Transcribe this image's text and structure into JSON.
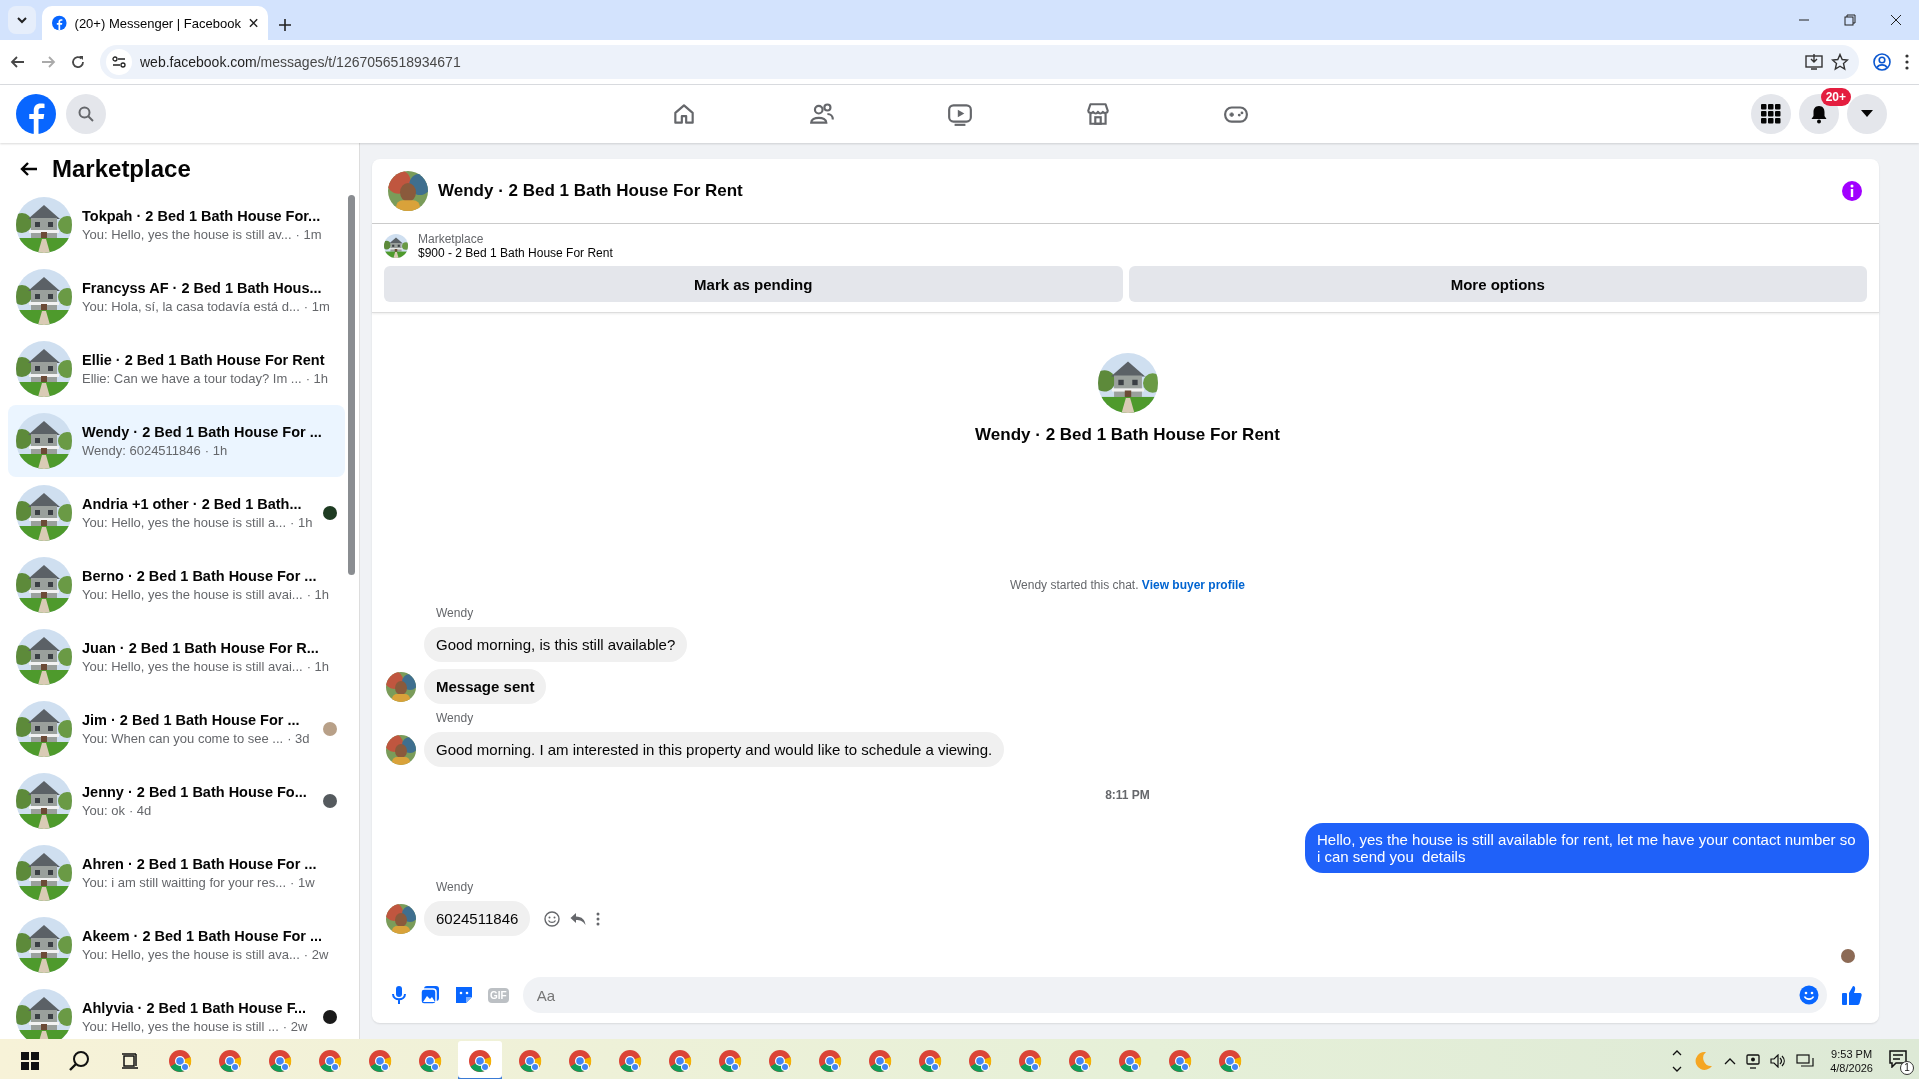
{
  "browser": {
    "tab_title": "(20+) Messenger | Facebook",
    "url_host": "web.facebook.com",
    "url_path": "/messages/t/1267056518934671"
  },
  "topbar": {
    "nav": [
      {
        "kind": "home"
      },
      {
        "kind": "friends"
      },
      {
        "kind": "video"
      },
      {
        "kind": "marketplace"
      },
      {
        "kind": "gaming"
      }
    ],
    "notification_badge": "20+"
  },
  "sidebar": {
    "title": "Marketplace",
    "conversations": [
      {
        "title": "Tokpah · 2 Bed 1 Bath House For...",
        "preview": "You: Hello, yes the house is still av...",
        "time": "· 1m",
        "selected": false
      },
      {
        "title": "Francyss AF · 2 Bed 1 Bath Hous...",
        "preview": "You: Hola, sí, la casa todavía está d...",
        "time": "· 1m",
        "selected": false
      },
      {
        "title": "Ellie · 2 Bed 1 Bath House For Rent",
        "preview": "Ellie: Can we have a tour today? Im ...",
        "time": "· 1h",
        "selected": false
      },
      {
        "title": "Wendy · 2 Bed 1 Bath House For ...",
        "preview": "Wendy: 6024511846",
        "time": "· 1h",
        "selected": true
      },
      {
        "title": "Andria +1 other · 2 Bed 1 Bath...",
        "preview": "You: Hello, yes the house is still a...",
        "time": "· 1h",
        "selected": false,
        "receipt": {
          "color": "#1e3b22"
        }
      },
      {
        "title": "Berno · 2 Bed 1 Bath House For ...",
        "preview": "You: Hello, yes the house is still avai...",
        "time": "· 1h",
        "selected": false
      },
      {
        "title": "Juan · 2 Bed 1 Bath House For R...",
        "preview": "You: Hello, yes the house is still avai...",
        "time": "· 1h",
        "selected": false
      },
      {
        "title": "Jim · 2 Bed 1 Bath House For ...",
        "preview": "You: When can you come to see ...",
        "time": "· 3d",
        "selected": false,
        "receipt": {
          "color": "#b8a088"
        }
      },
      {
        "title": "Jenny · 2 Bed 1 Bath House Fo...",
        "preview": "You: ok",
        "time": "· 4d",
        "selected": false,
        "receipt": {
          "color": "#555a5e"
        }
      },
      {
        "title": "Ahren · 2 Bed 1 Bath House For ...",
        "preview": "You: i am still waitting for your res...",
        "time": "· 1w",
        "selected": false
      },
      {
        "title": "Akeem · 2 Bed 1 Bath House For ...",
        "preview": "You: Hello, yes the house is still ava...",
        "time": "· 2w",
        "selected": false
      },
      {
        "title": "Ahlyvia · 2 Bed 1 Bath House F...",
        "preview": "You: Hello, yes the house is still ...",
        "time": "· 2w",
        "selected": false,
        "receipt": {
          "color": "#1a1a1a"
        }
      }
    ]
  },
  "chat": {
    "title": "Wendy · 2 Bed 1 Bath House For Rent",
    "listing": {
      "label": "Marketplace",
      "name": "$900 - 2 Bed 1 Bath House For Rent"
    },
    "buttons": [
      "Mark as pending",
      "More options"
    ],
    "intro_title": "Wendy · 2 Bed 1 Bath House For Rent",
    "started": {
      "text": "Wendy started this chat.",
      "link": "View buyer profile"
    },
    "messages": [
      {
        "kind": "sender",
        "text": "Wendy"
      },
      {
        "kind": "incoming",
        "text": "Good morning, is this still available?",
        "avatar": false,
        "bold": false
      },
      {
        "kind": "incoming",
        "text": "Message sent",
        "avatar": true,
        "bold": true
      },
      {
        "kind": "sender",
        "text": "Wendy"
      },
      {
        "kind": "incoming",
        "text": "Good morning. I am interested in this property and would like to schedule a viewing.",
        "avatar": true,
        "bold": false
      },
      {
        "kind": "time",
        "text": "8:11 PM"
      },
      {
        "kind": "outgoing",
        "text": "Hello, yes the house is still available for rent, let me have your contact number so i can send you  details"
      },
      {
        "kind": "sender",
        "text": "Wendy"
      },
      {
        "kind": "incoming",
        "text": "6024511846",
        "avatar": true,
        "bold": false,
        "actions": true
      },
      {
        "kind": "seen"
      }
    ],
    "composer": {
      "gif_label": "GIF",
      "placeholder": "Aa"
    }
  },
  "taskbar": {
    "apps": [
      {
        "selected": false
      },
      {
        "selected": false
      },
      {
        "selected": false
      },
      {
        "selected": false
      },
      {
        "selected": false
      },
      {
        "selected": false
      },
      {
        "selected": true
      },
      {
        "selected": false
      },
      {
        "selected": false
      },
      {
        "selected": false
      },
      {
        "selected": false
      },
      {
        "selected": false
      },
      {
        "selected": false
      },
      {
        "selected": false
      },
      {
        "selected": false
      },
      {
        "selected": false
      },
      {
        "selected": false
      },
      {
        "selected": false
      },
      {
        "selected": false
      },
      {
        "selected": false
      },
      {
        "selected": false
      },
      {
        "selected": false
      }
    ],
    "time": "9:53 PM",
    "date": "4/8/2026",
    "notification_count": "1"
  }
}
